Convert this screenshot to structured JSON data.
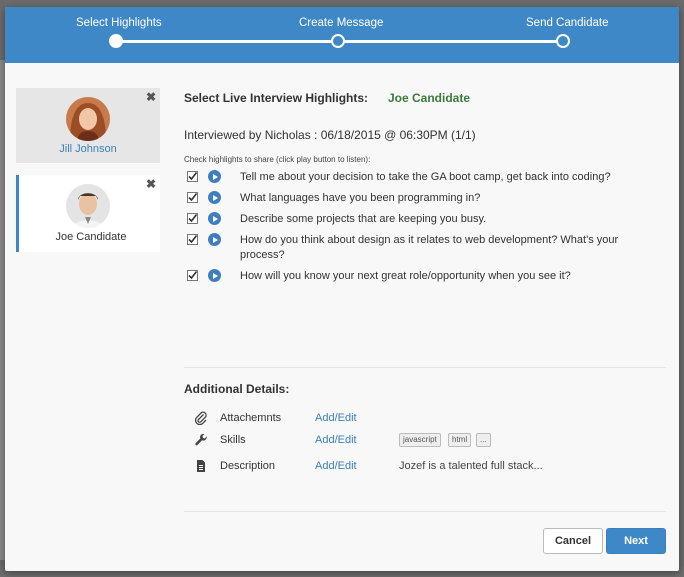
{
  "wizard": {
    "steps": [
      "Select Highlights",
      "Create Message",
      "Send Candidate"
    ],
    "current_step": 1
  },
  "sidebar": {
    "candidates": [
      {
        "name": "Jill Johnson",
        "close": "✖"
      },
      {
        "name": "Joe Candidate",
        "close": "✖"
      }
    ]
  },
  "main": {
    "title": "Select Live Interview Highlights:",
    "candidate": "Joe Candidate",
    "interview_line": "Interviewed by Nicholas : 06/18/2015 @ 06:30PM (1/1)",
    "hint": "Check highlights to share (click play button to listen):",
    "highlights": [
      "Tell me about your decision to take the GA boot camp, get back into coding?",
      "What languages have you been programming in?",
      "Describe some projects that are keeping you busy.",
      "How do you think about design as it relates to web development? What's your process?",
      "How will you know your next great role/opportunity when you see it?"
    ]
  },
  "details": {
    "title": "Additional Details:",
    "rows": [
      {
        "label": "Attachemnts",
        "link": "Add/Edit",
        "icon": "paperclip-icon"
      },
      {
        "label": "Skills",
        "link": "Add/Edit",
        "icon": "wrench-icon"
      },
      {
        "label": "Description",
        "link": "Add/Edit",
        "icon": "document-icon"
      }
    ],
    "skills": [
      "javascript",
      "html",
      "..."
    ],
    "description": "Jozef is a talented full stack..."
  },
  "buttons": {
    "cancel": "Cancel",
    "next": "Next"
  },
  "colors": {
    "header": "#3f88c8",
    "link": "#3a7fc1",
    "candidate_name": "#3c7a3c"
  }
}
